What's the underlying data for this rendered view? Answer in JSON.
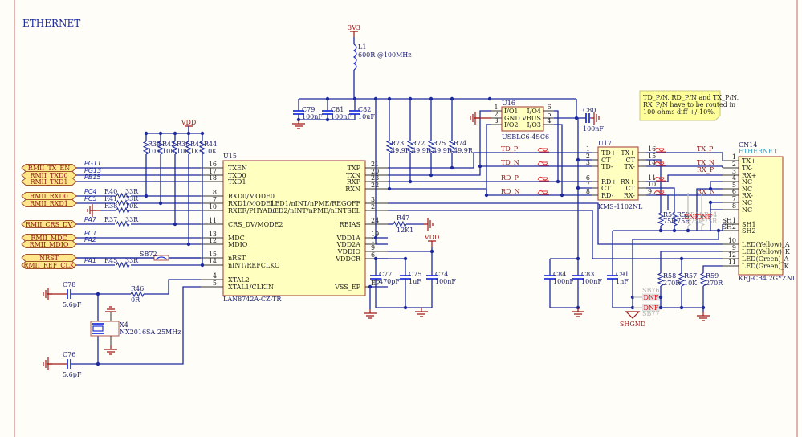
{
  "title": "ETHERNET",
  "u15": {
    "ref": "U15",
    "part": "LAN8742A-CZ-TR",
    "left": [
      {
        "n": "16",
        "name": "TXEN"
      },
      {
        "n": "17",
        "name": "TXD0"
      },
      {
        "n": "18",
        "name": "TXD1"
      },
      {
        "n": "8",
        "name": "RXD0/MODE0"
      },
      {
        "n": "7",
        "name": "RXD1/MODE1"
      },
      {
        "n": "10",
        "name": "RXER/PHYAD0"
      },
      {
        "n": "11",
        "name": "CRS_DV/MODE2"
      },
      {
        "n": "13",
        "name": "MDC"
      },
      {
        "n": "12",
        "name": "MDIO"
      },
      {
        "n": "15",
        "name": "nRST"
      },
      {
        "n": "14",
        "name": "nINT/REFCLKO"
      },
      {
        "n": "4",
        "name": "XTAL2"
      },
      {
        "n": "5",
        "name": "XTAL1/CLKIN"
      }
    ],
    "right": [
      {
        "n": "21",
        "name": "TXP"
      },
      {
        "n": "20",
        "name": "TXN"
      },
      {
        "n": "23",
        "name": "RXP"
      },
      {
        "n": "22",
        "name": "RXN"
      },
      {
        "n": "3",
        "name": "LED1/nINT/nPME/REGOFF"
      },
      {
        "n": "2",
        "name": "LED2/nINT/nPME/nINTSEL"
      },
      {
        "n": "24",
        "name": "RBIAS"
      },
      {
        "n": "19",
        "name": "VDD1A"
      },
      {
        "n": "1",
        "name": "VDD2A"
      },
      {
        "n": "9",
        "name": "VDDIO"
      },
      {
        "n": "6",
        "name": "VDDCR"
      },
      {
        "n": "EP",
        "name": "VSS_EP"
      }
    ]
  },
  "nets": [
    {
      "label": "RMII_TX_EN",
      "port": "PG11"
    },
    {
      "label": "RMII_TXD0",
      "port": "PG13"
    },
    {
      "label": "RMII_TXD1",
      "port": "PB15"
    },
    {
      "label": "RMII_RXD0",
      "port": "PC4"
    },
    {
      "label": "RMII_RXD1",
      "port": "PC5"
    },
    {
      "label": "RMII_CRS_DV",
      "port": "PA7"
    },
    {
      "label": "RMII_MDC",
      "port": "PC1"
    },
    {
      "label": "RMII_MDIO",
      "port": "PA2"
    },
    {
      "label": "NRST",
      "port": ""
    },
    {
      "label": "RMII_REF_CLK",
      "port": "PA1"
    }
  ],
  "series_res": [
    {
      "ref": "R40",
      "value": "33R"
    },
    {
      "ref": "R41",
      "value": "33R"
    },
    {
      "ref": "R38",
      "value": "10K"
    },
    {
      "ref": "R37",
      "value": "33R"
    },
    {
      "ref": "R45",
      "value": "33R"
    }
  ],
  "pullups": [
    {
      "ref": "R39",
      "value": "10K"
    },
    {
      "ref": "R42",
      "value": "10K"
    },
    {
      "ref": "R36",
      "value": "10K"
    },
    {
      "ref": "R43",
      "value": "1K5"
    },
    {
      "ref": "R44",
      "value": "10K"
    }
  ],
  "vdd": "VDD",
  "sb72": "SB72",
  "crystal": {
    "c78": {
      "ref": "C78",
      "value": "5.6pF"
    },
    "c76": {
      "ref": "C76",
      "value": "5.6pF"
    },
    "r46": {
      "ref": "R46",
      "value": "0R"
    },
    "x4": {
      "ref": "X4",
      "value": "NX2016SA 25MHz"
    }
  },
  "power": {
    "supply": "3V3",
    "l1": {
      "ref": "L1",
      "value": "600R @100MHz"
    },
    "caps": [
      {
        "ref": "C79",
        "value": "100nF"
      },
      {
        "ref": "C81",
        "value": "100nF"
      },
      {
        "ref": "C82",
        "value": "10uF"
      }
    ]
  },
  "terminations": [
    {
      "ref": "R73",
      "value": "49.9R"
    },
    {
      "ref": "R72",
      "value": "49.9R"
    },
    {
      "ref": "R75",
      "value": "49.9R"
    },
    {
      "ref": "R74",
      "value": "49.9R"
    }
  ],
  "u16": {
    "ref": "U16",
    "part": "USBLC6-4SC6",
    "left": [
      {
        "n": "1",
        "name": "I/O1"
      },
      {
        "n": "2",
        "name": "GND"
      },
      {
        "n": "3",
        "name": "I/O2"
      }
    ],
    "right": [
      {
        "n": "6",
        "name": "I/O4"
      },
      {
        "n": "5",
        "name": "VBUS"
      },
      {
        "n": "4",
        "name": "I/O3"
      }
    ]
  },
  "c80": {
    "ref": "C80",
    "value": "100nF"
  },
  "diff_nets": [
    "TD_P",
    "TD_N",
    "RD_P",
    "RD_N"
  ],
  "u17": {
    "ref": "U17",
    "part": "KMS-1102NL",
    "left": [
      {
        "n": "1",
        "name": "TD+"
      },
      {
        "n": "2",
        "name": "CT"
      },
      {
        "n": "3",
        "name": "TD-"
      },
      {
        "n": "6",
        "name": "RD+"
      },
      {
        "n": "7",
        "name": "CT"
      },
      {
        "n": "8",
        "name": "RD-"
      }
    ],
    "right": [
      {
        "n": "16",
        "name": "TX+"
      },
      {
        "n": "15",
        "name": "CT"
      },
      {
        "n": "14",
        "name": "TX-"
      },
      {
        "n": "11",
        "name": "RX+"
      },
      {
        "n": "10",
        "name": "CT"
      },
      {
        "n": "9",
        "name": "RX-"
      }
    ]
  },
  "cn14": {
    "ref": "CN14",
    "sublabel": "ETHERNET",
    "part": "KRJ-CB4.2GYZNL",
    "pins": [
      {
        "n": "1",
        "name": "TX+"
      },
      {
        "n": "2",
        "name": "TX-"
      },
      {
        "n": "3",
        "name": "RX+"
      },
      {
        "n": "4",
        "name": "NC"
      },
      {
        "n": "5",
        "name": "NC"
      },
      {
        "n": "6",
        "name": "RX-"
      },
      {
        "n": "7",
        "name": "NC"
      },
      {
        "n": "8",
        "name": "NC"
      },
      {
        "n": "SH1",
        "name": "SH1"
      },
      {
        "n": "SH2",
        "name": "SH2"
      },
      {
        "n": "10",
        "name": "LED(Yellow)_A"
      },
      {
        "n": "9",
        "name": "LED(Yellow)_K"
      },
      {
        "n": "12",
        "name": "LED(Green)_A"
      },
      {
        "n": "11",
        "name": "LED(Green)_K"
      }
    ]
  },
  "cn_nets": [
    "TX_P",
    "TX_N",
    "RX_P",
    "RX_N"
  ],
  "note": [
    "TD_P/N, RD_P/N and TX_P/N,",
    "RX_P/N have to be routed in",
    "100 ohms diff +/-10%."
  ],
  "shield_res": [
    {
      "ref": "R51",
      "value": "75R"
    },
    {
      "ref": "R52",
      "value": "75R"
    },
    {
      "ref": "R53",
      "value": "75R"
    },
    {
      "ref": "R54",
      "value": "75R"
    }
  ],
  "dnf": "DNF",
  "lower_caps": [
    {
      "ref": "C84",
      "value": "100nF"
    },
    {
      "ref": "C83",
      "value": "100nF"
    },
    {
      "ref": "C91",
      "value": "1nF"
    }
  ],
  "led_res": [
    {
      "ref": "R58",
      "value": "270R"
    },
    {
      "ref": "R57",
      "value": "10K"
    },
    {
      "ref": "R59",
      "value": "270R"
    }
  ],
  "sb": [
    "SB76",
    "SB77"
  ],
  "shgnd": "SHGND",
  "r47": {
    "ref": "R47",
    "value": "12K1"
  },
  "vdd_caps": [
    {
      "ref": "C77",
      "value": "470pF"
    },
    {
      "ref": "C75",
      "value": "1uF"
    },
    {
      "ref": "C74",
      "value": "100nF"
    }
  ],
  "colors": {
    "wire": "#1c2a9e",
    "component_fill": "#ffffc0",
    "component_stroke": "#b05a50",
    "power": "#a01818",
    "diff_directive": "#e03030"
  }
}
